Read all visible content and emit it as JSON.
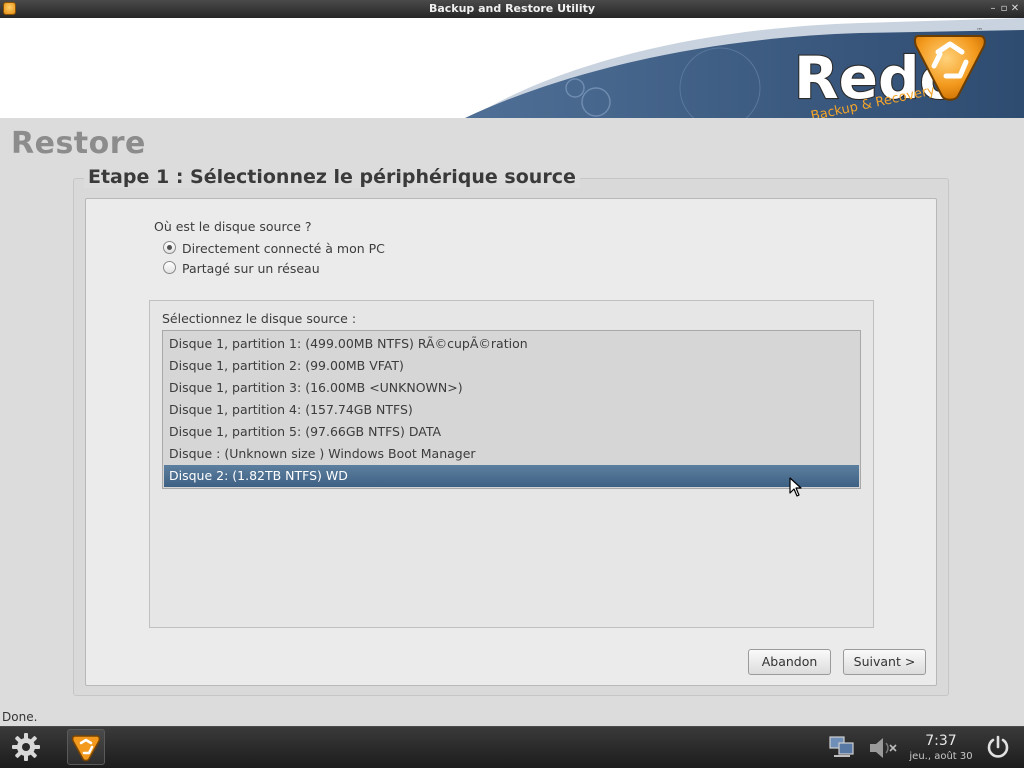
{
  "window": {
    "title": "Backup and Restore Utility"
  },
  "brand": {
    "name": "Redo",
    "tagline": "Backup & Recovery",
    "trademark": "™"
  },
  "page": {
    "title": "Restore"
  },
  "step": {
    "title": "Etape 1 : Sélectionnez le périphérique source"
  },
  "source_question": {
    "label": "Où est le disque source ?",
    "options": [
      {
        "label": "Directement connecté à mon PC",
        "checked": true
      },
      {
        "label": "Partagé sur un réseau",
        "checked": false
      }
    ]
  },
  "disk_select": {
    "label": "Sélectionnez le disque source :",
    "items": [
      {
        "label": "Disque 1, partition 1: (499.00MB NTFS) RÃ©cupÃ©ration",
        "selected": false
      },
      {
        "label": "Disque 1, partition 2: (99.00MB VFAT)",
        "selected": false
      },
      {
        "label": "Disque 1, partition 3: (16.00MB <UNKNOWN>)",
        "selected": false
      },
      {
        "label": "Disque 1, partition 4: (157.74GB NTFS)",
        "selected": false
      },
      {
        "label": "Disque 1, partition 5: (97.66GB NTFS) DATA",
        "selected": false
      },
      {
        "label": "Disque : (Unknown size ) Windows Boot Manager",
        "selected": false
      },
      {
        "label": "Disque 2: (1.82TB NTFS) WD",
        "selected": true
      }
    ]
  },
  "buttons": {
    "cancel": "Abandon",
    "next": "Suivant >"
  },
  "status": {
    "text": "Done."
  },
  "taskbar": {
    "clock_time": "7:37",
    "clock_date": "jeu., août 30",
    "icons": [
      "gear-icon",
      "redo-app-icon",
      "network-icon",
      "volume-muted-icon",
      "power-icon"
    ]
  },
  "colors": {
    "selection": "#4a6d90",
    "banner_wave": "#3d5f8a",
    "brand_orange": "#f39a1e"
  }
}
